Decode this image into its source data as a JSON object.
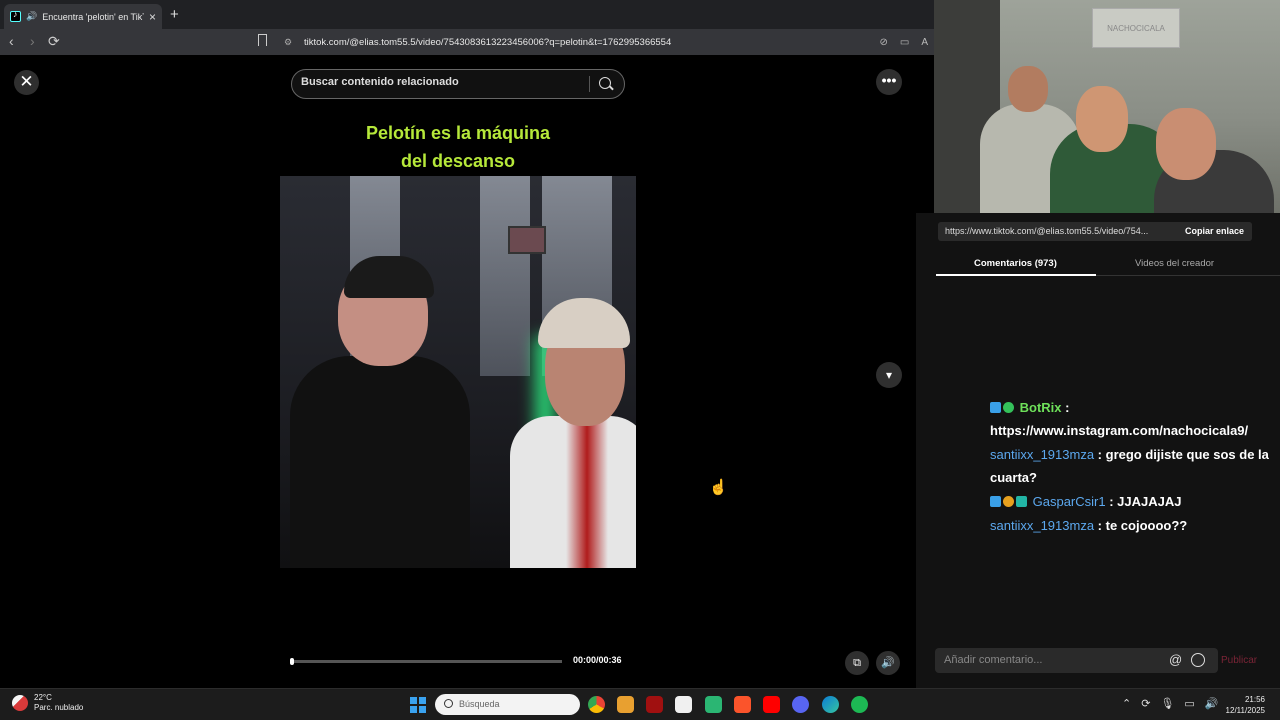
{
  "browser": {
    "tab_title": "Encuentra 'pelotin' en TikTok",
    "tab_close": "×",
    "new_tab": "+",
    "back": "‹",
    "forward": "›",
    "reload": "⟳",
    "url": "tiktok.com/@elias.tom55.5/video/7543083613223456006?q=pelotin&t=1762995366554"
  },
  "page": {
    "close": "✕",
    "search_placeholder": "Buscar contenido relacionado",
    "more": "•••",
    "down": "⌄",
    "video_caption_line1": "Pelotín es la máquina",
    "video_caption_line2": "del descanso",
    "time": "00:00/00:36",
    "progress_fraction": 0.0
  },
  "panel": {
    "share_link": "https://www.tiktok.com/@elias.tom55.5/video/754...",
    "copy_link": "Copiar enlace",
    "tab_comments": "Comentarios (973)",
    "tab_creator_videos": "Videos del creador",
    "comment_placeholder": "Añadir comentario...",
    "at_symbol": "@",
    "publish": "Publicar"
  },
  "webcam": {
    "sign": "NACHOCICALA"
  },
  "chat": [
    {
      "user": "BotRix",
      "text": "https://www.instagram.com/nachocicala9/"
    },
    {
      "user": "santiixx_1913mza",
      "text": "grego dijiste que sos de la cuarta?"
    },
    {
      "user": "GasparCsir1",
      "text": "JJAJAJAJ"
    },
    {
      "user": "santiixx_1913mza",
      "text": "te cojoooo??"
    }
  ],
  "taskbar": {
    "temp": "22°C",
    "weather": "Parc. nublado",
    "search_placeholder": "Búsqueda",
    "time": "21:56",
    "date": "12/11/2025"
  },
  "colors": {
    "caption": "#b6e83a",
    "bot_user": "#6ee05a",
    "chat_user": "#5ca8ee",
    "publish": "#7a2436"
  }
}
